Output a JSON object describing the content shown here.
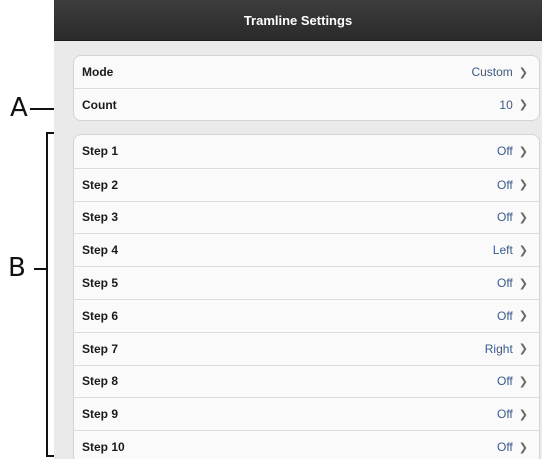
{
  "header": {
    "title": "Tramline Settings"
  },
  "general": [
    {
      "label": "Mode",
      "value": "Custom"
    },
    {
      "label": "Count",
      "value": "10"
    }
  ],
  "steps": [
    {
      "label": "Step 1",
      "value": "Off"
    },
    {
      "label": "Step 2",
      "value": "Off"
    },
    {
      "label": "Step 3",
      "value": "Off"
    },
    {
      "label": "Step 4",
      "value": "Left"
    },
    {
      "label": "Step 5",
      "value": "Off"
    },
    {
      "label": "Step 6",
      "value": "Off"
    },
    {
      "label": "Step 7",
      "value": "Right"
    },
    {
      "label": "Step 8",
      "value": "Off"
    },
    {
      "label": "Step 9",
      "value": "Off"
    },
    {
      "label": "Step 10",
      "value": "Off"
    }
  ],
  "callouts": {
    "a": "A",
    "b": "B"
  },
  "chevron_icon": "chevron-right-icon",
  "colors": {
    "titlebar": "#2f2f2f",
    "value_text": "#3b5a8a",
    "background": "#eaeaea"
  }
}
